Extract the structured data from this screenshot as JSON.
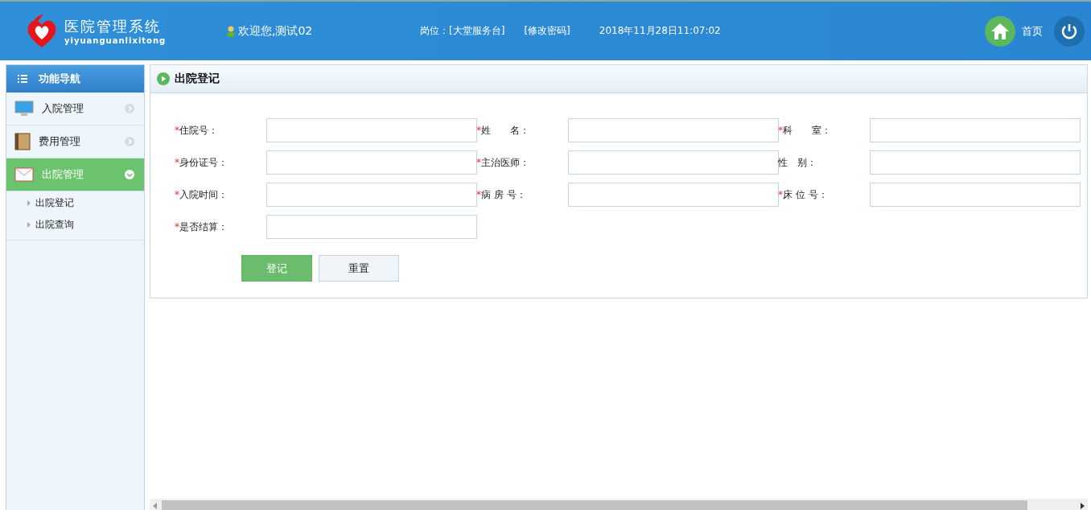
{
  "header": {
    "logo_title": "医院管理系统",
    "logo_subtitle": "yiyuanguanlixitong",
    "welcome": "欢迎您,测试02",
    "post": "岗位：[大堂服务台]",
    "change_password": "[修改密码]",
    "datetime": "2018年11月28日11:07:02",
    "home": "首页"
  },
  "sidebar": {
    "title": "功能导航",
    "items": [
      {
        "label": "入院管理",
        "kind": "monitor",
        "expanded": false
      },
      {
        "label": "费用管理",
        "kind": "book",
        "expanded": false
      },
      {
        "label": "出院管理",
        "kind": "mail",
        "expanded": true,
        "children": [
          {
            "label": "出院登记"
          },
          {
            "label": "出院查询"
          }
        ]
      }
    ]
  },
  "panel": {
    "title": "出院登记",
    "fields": [
      {
        "mark": "*",
        "label": "住院号："
      },
      {
        "mark": "*",
        "label": "姓　　名："
      },
      {
        "mark": "*",
        "label": "科　　室："
      },
      {
        "mark": "*",
        "label": "身份证号："
      },
      {
        "mark": "*",
        "label": "主治医师："
      },
      {
        "label": "性　别："
      },
      {
        "mark": "*",
        "label": "入院时间："
      },
      {
        "mark": "*",
        "label": "病 房 号："
      },
      {
        "mark": "*",
        "label": "床 位 号："
      },
      {
        "mark": "*",
        "label": "是否结算："
      }
    ],
    "buttons": [
      {
        "label": "登记",
        "kind": "primary"
      },
      {
        "label": "重置",
        "kind": "secondary"
      }
    ]
  }
}
